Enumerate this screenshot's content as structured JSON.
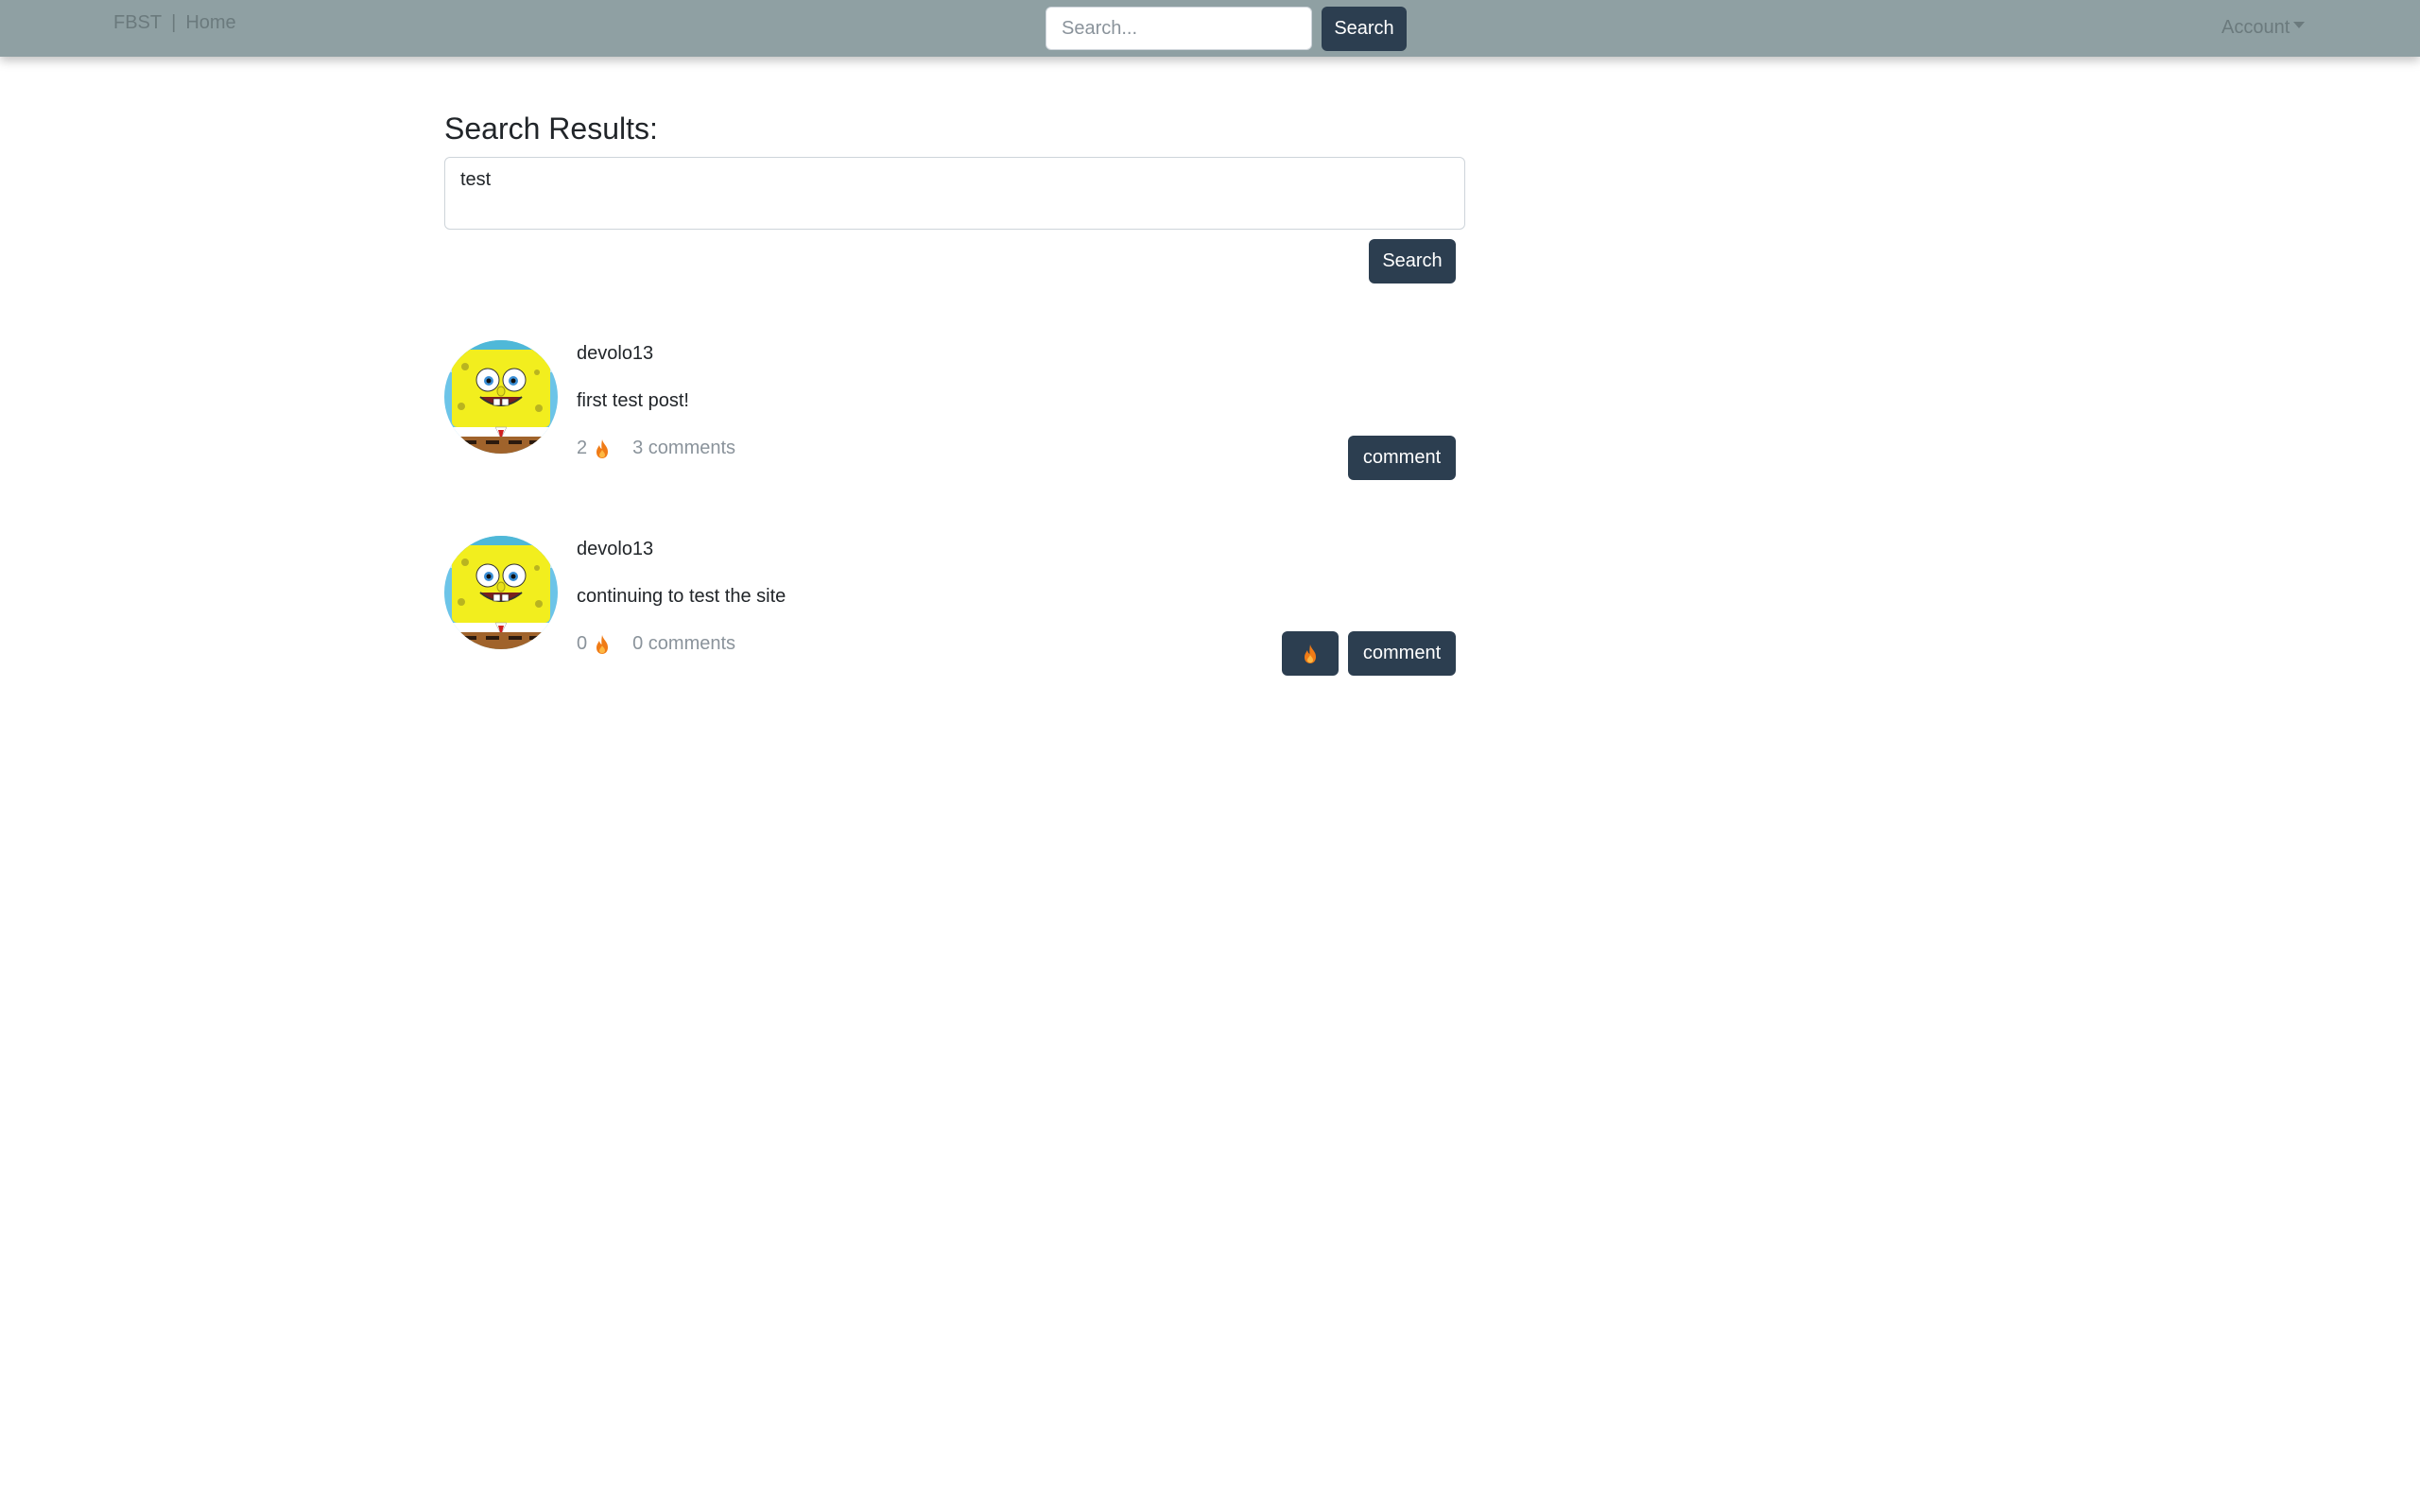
{
  "navbar": {
    "brand": "FBST",
    "separator": "|",
    "home": "Home",
    "search_placeholder": "Search...",
    "search_button": "Search",
    "account": "Account"
  },
  "main": {
    "title": "Search Results:",
    "query_value": "test",
    "search_button": "Search"
  },
  "posts": [
    {
      "username": "devolo13",
      "text": "first test post!",
      "fire_count": "2",
      "comments": "3 comments",
      "comment_button": "comment",
      "has_fire_button": false
    },
    {
      "username": "devolo13",
      "text": "continuing to test the site",
      "fire_count": "0",
      "comments": "0 comments",
      "comment_button": "comment",
      "has_fire_button": true
    }
  ],
  "colors": {
    "navbar": "#8fa0a3",
    "button": "#2c3e50",
    "flame": "#f07b16",
    "muted_text": "#8a939b"
  },
  "icons": {
    "flame": "flame-icon",
    "caret": "caret-down-icon",
    "avatar": "spongebob-avatar"
  }
}
